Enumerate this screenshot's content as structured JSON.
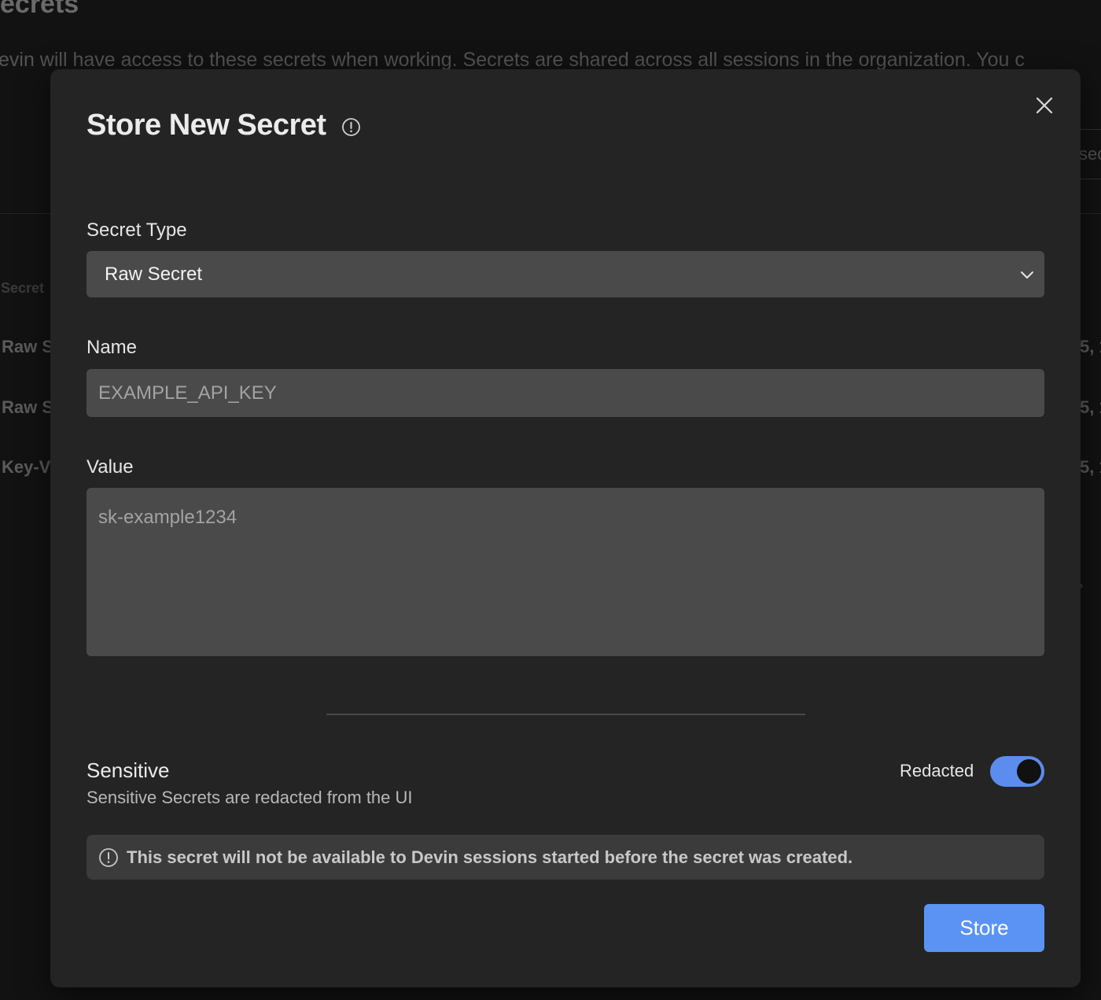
{
  "background": {
    "title_fragment": "ecrets",
    "description_fragment": "evin will have access to these secrets when working. Secrets are shared across all sessions in the organization. You c",
    "search_fragment": "sec",
    "column_header_fragment": "Secret",
    "rows": [
      {
        "type_fragment": "Raw S",
        "date_fragment": "5, 1"
      },
      {
        "type_fragment": "Raw S",
        "date_fragment": "5, 1"
      },
      {
        "type_fragment": "Key-V",
        "date_fragment": "5, 1"
      }
    ],
    "chevron_glyph": "›"
  },
  "modal": {
    "title": "Store New Secret",
    "title_icon": "info-circle-icon",
    "close_icon": "close-icon",
    "secret_type": {
      "label": "Secret Type",
      "selected": "Raw Secret",
      "chevron_icon": "chevron-down-icon"
    },
    "name": {
      "label": "Name",
      "value": "",
      "placeholder": "EXAMPLE_API_KEY"
    },
    "value": {
      "label": "Value",
      "value": "",
      "placeholder": "sk-example1234"
    },
    "sensitive": {
      "title": "Sensitive",
      "subtitle": "Sensitive Secrets are redacted from the UI",
      "toggle_label": "Redacted",
      "toggle_on": true
    },
    "notice": {
      "icon": "info-circle-icon",
      "text": "This secret will not be available to Devin sessions started before the secret was created."
    },
    "store_label": "Store"
  },
  "colors": {
    "accent": "#5b93f5",
    "toggle_on": "#5b8def",
    "modal_bg": "#242424",
    "field_bg": "#4a4a4a"
  }
}
